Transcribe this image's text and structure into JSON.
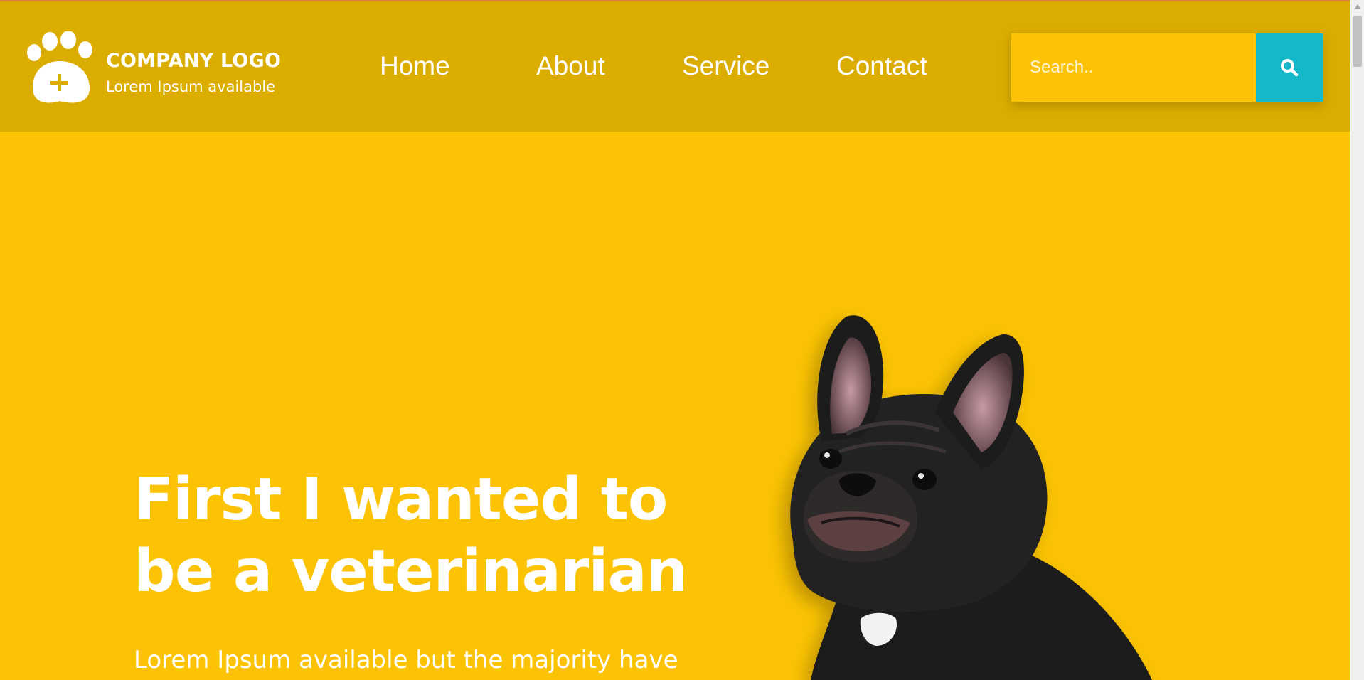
{
  "header": {
    "logo_title": "COMPANY LOGO",
    "logo_subtitle": "Lorem Ipsum available",
    "nav": {
      "home": "Home",
      "about": "About",
      "service": "Service",
      "contact": "Contact"
    },
    "search": {
      "placeholder": "Search.."
    }
  },
  "hero": {
    "title": "First I wanted to be a veterinarian",
    "text": "Lorem Ipsum available but the majority have"
  },
  "colors": {
    "background": "#fbc303",
    "header": "#dbad00",
    "search_button": "#14b8c8",
    "text": "#ffffff"
  },
  "icons": {
    "logo": "paw-plus-icon",
    "search": "search-icon",
    "scroll_up": "scroll-up-arrow-icon"
  }
}
